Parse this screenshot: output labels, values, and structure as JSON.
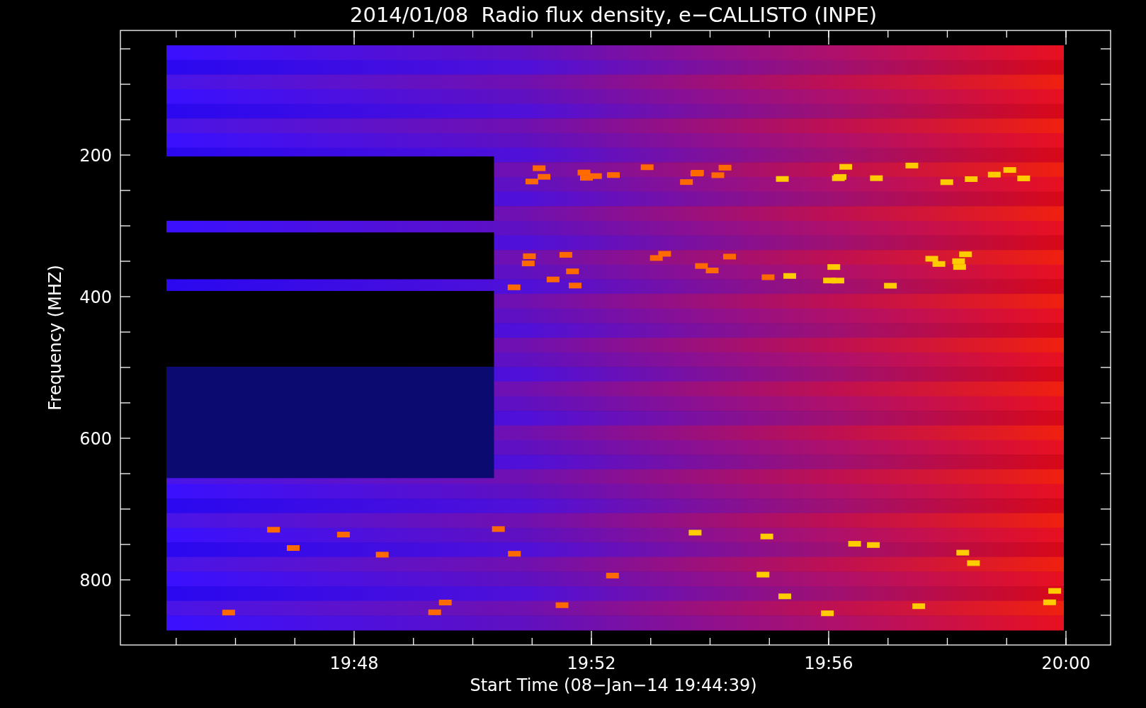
{
  "title": "2014/01/08  Radio flux density, e−CALLISTO (INPE)",
  "y_axis": {
    "label": "Frequency (MHZ)",
    "ticks": [
      "200",
      "400",
      "600",
      "800"
    ]
  },
  "x_axis": {
    "label": "Start Time (08−Jan−14 19:44:39)",
    "ticks": [
      "19:48",
      "19:52",
      "19:56",
      "20:00"
    ]
  }
}
